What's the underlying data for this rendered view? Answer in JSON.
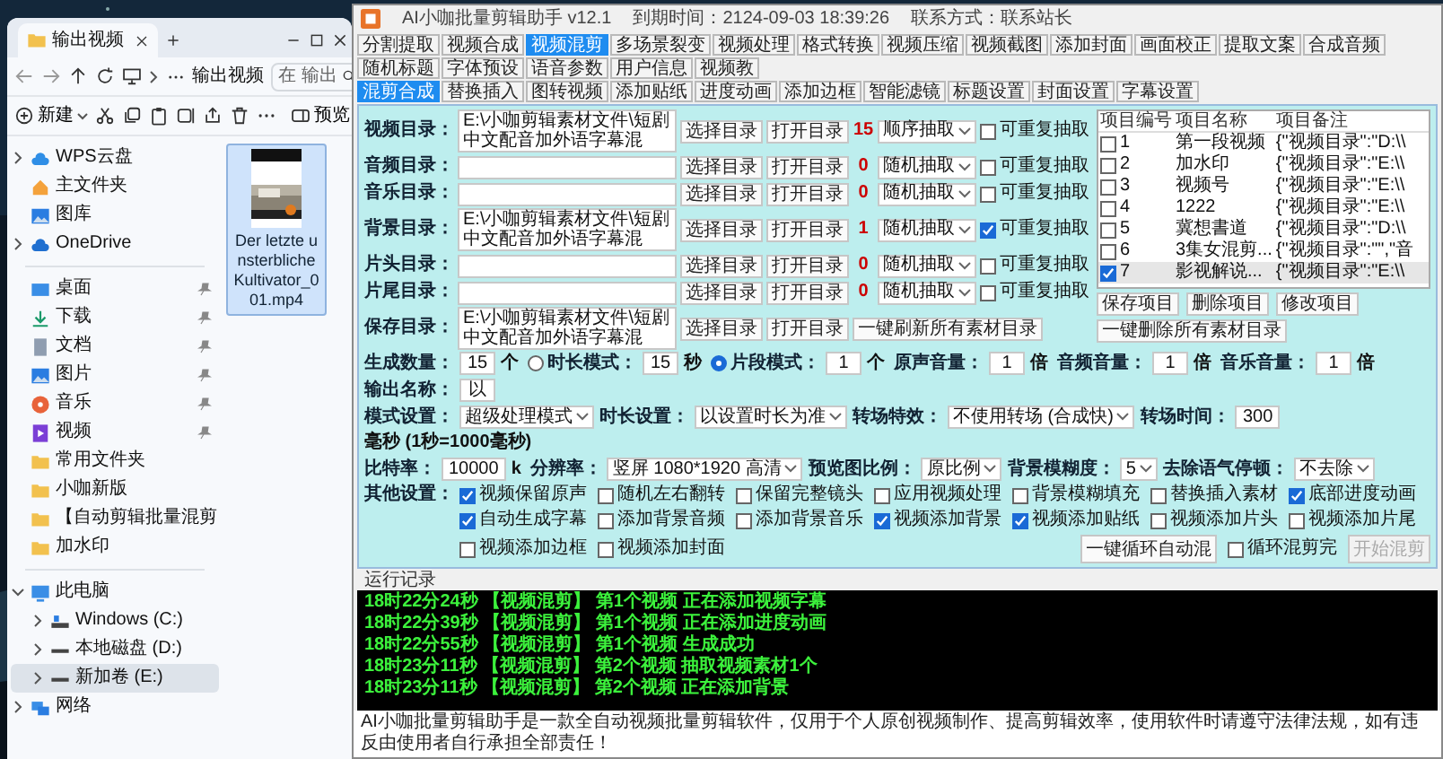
{
  "explorer": {
    "tab_title": "输出视频",
    "breadcrumb": "输出视频",
    "search": {
      "placeholder": "在 输出"
    },
    "new_label": "新建",
    "preview_label": "预览",
    "sidebar": {
      "sections": [
        [
          {
            "label": "WPS云盘",
            "expanded": false,
            "selected": false
          },
          {
            "label": "主文件夹",
            "selected": false
          },
          {
            "label": "图库",
            "selected": false
          },
          {
            "label": "OneDrive",
            "expanded": false,
            "selected": false
          }
        ],
        [
          {
            "label": "桌面",
            "pinned": true,
            "selected": false
          },
          {
            "label": "下载",
            "pinned": true,
            "selected": false
          },
          {
            "label": "文档",
            "pinned": true,
            "selected": false
          },
          {
            "label": "图片",
            "pinned": true,
            "selected": false
          },
          {
            "label": "音乐",
            "pinned": true,
            "selected": false
          },
          {
            "label": "视频",
            "pinned": true,
            "selected": false
          },
          {
            "label": "常用文件夹",
            "pinned": false,
            "selected": false
          },
          {
            "label": "小咖新版",
            "pinned": false,
            "selected": false
          },
          {
            "label": "【自动剪辑批量混剪",
            "pinned": false,
            "selected": false
          },
          {
            "label": "加水印",
            "pinned": false,
            "selected": false
          }
        ],
        [
          {
            "label": "此电脑",
            "expanded": true,
            "selected": false,
            "children": [
              {
                "label": "Windows (C:)",
                "expanded": false,
                "selected": false
              },
              {
                "label": "本地磁盘 (D:)",
                "expanded": false,
                "selected": false
              },
              {
                "label": "新加卷 (E:)",
                "expanded": false,
                "selected": true
              }
            ]
          },
          {
            "label": "网络",
            "expanded": false,
            "selected": false
          }
        ]
      ]
    },
    "files": [
      {
        "name": "Der letzte unsterbliche Kultivator_001.mp4",
        "selected": true
      }
    ]
  },
  "app": {
    "title": "AI小咖批量剪辑助手 v12.1",
    "expiry": "到期时间：2124-09-03 18:39:26",
    "contact": "联系方式：联系站长",
    "tabs": [
      {
        "label": "分割提取",
        "selected": false
      },
      {
        "label": "视频合成",
        "selected": false
      },
      {
        "label": "视频混剪",
        "selected": true
      },
      {
        "label": "多场景裂变",
        "selected": false
      },
      {
        "label": "视频处理",
        "selected": false
      },
      {
        "label": "格式转换",
        "selected": false
      },
      {
        "label": "视频压缩",
        "selected": false
      },
      {
        "label": "视频截图",
        "selected": false
      },
      {
        "label": "添加封面",
        "selected": false
      },
      {
        "label": "画面校正",
        "selected": false
      },
      {
        "label": "提取文案",
        "selected": false
      },
      {
        "label": "合成音频",
        "selected": false
      },
      {
        "label": "随机标题",
        "selected": false
      },
      {
        "label": "字体预设",
        "selected": false
      },
      {
        "label": "语音参数",
        "selected": false
      },
      {
        "label": "用户信息",
        "selected": false
      },
      {
        "label": "视频教",
        "selected": false
      }
    ],
    "subtabs": [
      {
        "label": "混剪合成",
        "selected": true
      },
      {
        "label": "替换插入",
        "selected": false
      },
      {
        "label": "图转视频",
        "selected": false
      },
      {
        "label": "添加贴纸",
        "selected": false
      },
      {
        "label": "进度动画",
        "selected": false
      },
      {
        "label": "添加边框",
        "selected": false
      },
      {
        "label": "智能滤镜",
        "selected": false
      },
      {
        "label": "标题设置",
        "selected": false
      },
      {
        "label": "封面设置",
        "selected": false
      },
      {
        "label": "字幕设置",
        "selected": false
      }
    ],
    "directories": [
      {
        "label": "视频目录：",
        "path": "E:\\小咖剪辑素材文件\\短剧中文配音加外语字幕混",
        "choose_button": "选择目录",
        "open_button": "打开目录",
        "count": "15",
        "order": "顺序抽取",
        "repeat": {
          "label": "可重复抽取",
          "checked": false
        }
      },
      {
        "label": "音频目录：",
        "choose_button": "选择目录",
        "open_button": "打开目录",
        "count": "0",
        "order": "随机抽取",
        "repeat": {
          "label": "可重复抽取",
          "checked": false
        }
      },
      {
        "label": "音乐目录：",
        "choose_button": "选择目录",
        "open_button": "打开目录",
        "count": "0",
        "order": "随机抽取",
        "repeat": {
          "label": "可重复抽取",
          "checked": false
        }
      },
      {
        "label": "背景目录：",
        "path": "E:\\小咖剪辑素材文件\\短剧中文配音加外语字幕混",
        "choose_button": "选择目录",
        "open_button": "打开目录",
        "count": "1",
        "order": "随机抽取",
        "repeat": {
          "label": "可重复抽取",
          "checked": true
        }
      },
      {
        "label": "片头目录：",
        "choose_button": "选择目录",
        "open_button": "打开目录",
        "count": "0",
        "order": "随机抽取",
        "repeat": {
          "label": "可重复抽取",
          "checked": false
        }
      },
      {
        "label": "片尾目录：",
        "choose_button": "选择目录",
        "open_button": "打开目录",
        "count": "0",
        "order": "随机抽取",
        "repeat": {
          "label": "可重复抽取",
          "checked": false
        }
      },
      {
        "label": "保存目录：",
        "path": "E:\\小咖剪辑素材文件\\短剧中文配音加外语字幕混",
        "choose_button": "选择目录",
        "open_button": "打开目录",
        "action_button": "一键刷新所有素材目录"
      }
    ],
    "projects": {
      "columns": [
        "项目编号",
        "项目名称",
        "项目备注"
      ],
      "rows": [
        {
          "number": "1",
          "name": "第一段视频",
          "note": "{\"视频目录\":\"D:\\\\",
          "checked": false
        },
        {
          "number": "2",
          "name": "加水印",
          "note": "{\"视频目录\":\"E:\\\\",
          "checked": false
        },
        {
          "number": "3",
          "name": "视频号",
          "note": "{\"视频目录\":\"E:\\\\",
          "checked": false
        },
        {
          "number": "4",
          "name": "1222",
          "note": "{\"视频目录\":\"E:\\\\",
          "checked": false
        },
        {
          "number": "5",
          "name": "冀想書道",
          "note": "{\"视频目录\":\"D:\\\\",
          "checked": false
        },
        {
          "number": "6",
          "name": "3集女混剪...",
          "note": "{\"视频目录\":\"\",\"音",
          "checked": false
        },
        {
          "number": "7",
          "name": "影视解说...",
          "note": "{\"视频目录\":\"E:\\\\",
          "checked": true
        }
      ],
      "buttons": [
        "保存项目",
        "删除项目",
        "修改项目"
      ],
      "clear_button": "一键删除所有素材目录"
    },
    "settings": [
      [
        {
          "kind": "label",
          "text": "生成数量："
        },
        {
          "kind": "input",
          "value": "15"
        },
        {
          "kind": "unit",
          "text": "个"
        },
        {
          "kind": "radio",
          "text": "时长模式：",
          "selected": false
        },
        {
          "kind": "input",
          "value": "15"
        },
        {
          "kind": "unit",
          "text": "秒"
        },
        {
          "kind": "radio",
          "text": "片段模式：",
          "selected": true
        },
        {
          "kind": "input",
          "value": "1"
        },
        {
          "kind": "unit",
          "text": "个"
        },
        {
          "kind": "label",
          "text": "原声音量："
        },
        {
          "kind": "input",
          "value": "1"
        },
        {
          "kind": "unit",
          "text": "倍"
        },
        {
          "kind": "label",
          "text": "音频音量："
        },
        {
          "kind": "input",
          "value": "1"
        },
        {
          "kind": "unit",
          "text": "倍"
        },
        {
          "kind": "label",
          "text": "音乐音量："
        },
        {
          "kind": "input",
          "value": "1"
        },
        {
          "kind": "unit",
          "text": "倍"
        },
        {
          "kind": "label",
          "text": "输出名称："
        },
        {
          "kind": "input",
          "value": "以"
        }
      ],
      [
        {
          "kind": "label",
          "text": "模式设置："
        },
        {
          "kind": "select",
          "value": "超级处理模式"
        },
        {
          "kind": "label",
          "text": "时长设置："
        },
        {
          "kind": "select",
          "value": "以设置时长为准"
        },
        {
          "kind": "label",
          "text": "转场特效："
        },
        {
          "kind": "select",
          "value": "不使用转场 (合成快)"
        },
        {
          "kind": "label",
          "text": "转场时间："
        },
        {
          "kind": "input",
          "value": "300"
        },
        {
          "kind": "unit",
          "text": "毫秒 (1秒=1000毫秒)"
        }
      ],
      [
        {
          "kind": "label",
          "text": "比特率："
        },
        {
          "kind": "input",
          "value": "10000"
        },
        {
          "kind": "unit",
          "text": "k"
        },
        {
          "kind": "label",
          "text": "分辨率："
        },
        {
          "kind": "select",
          "value": "竖屏 1080*1920 高清"
        },
        {
          "kind": "label",
          "text": "预览图比例："
        },
        {
          "kind": "select",
          "value": "原比例"
        },
        {
          "kind": "label",
          "text": "背景模糊度："
        },
        {
          "kind": "select",
          "value": "5"
        },
        {
          "kind": "label",
          "text": "去除语气停顿："
        },
        {
          "kind": "select",
          "value": "不去除"
        }
      ]
    ],
    "options": {
      "label": "其他设置：",
      "items": [
        {
          "label": "视频保留原声",
          "checked": true
        },
        {
          "label": "随机左右翻转",
          "checked": false
        },
        {
          "label": "保留完整镜头",
          "checked": false
        },
        {
          "label": "应用视频处理",
          "checked": false
        },
        {
          "label": "背景模糊填充",
          "checked": false
        },
        {
          "label": "替换插入素材",
          "checked": false
        },
        {
          "label": "底部进度动画",
          "checked": true
        },
        {
          "label": "自动生成字幕",
          "checked": true
        },
        {
          "label": "添加背景音频",
          "checked": false
        },
        {
          "label": "添加背景音乐",
          "checked": false
        },
        {
          "label": "视频添加背景",
          "checked": true
        },
        {
          "label": "视频添加贴纸",
          "checked": true
        },
        {
          "label": "视频添加片头",
          "checked": false
        },
        {
          "label": "视频添加片尾",
          "checked": false
        },
        {
          "label": "视频添加边框",
          "checked": false
        },
        {
          "label": "视频添加封面",
          "checked": false
        }
      ]
    },
    "loop_button": "一键循环自动混",
    "loop_check": {
      "label": "循环混剪完",
      "checked": false
    },
    "start_button": {
      "label": "开始混剪",
      "disabled": true
    },
    "log": {
      "title": "运行记录",
      "lines": [
        "18时22分24秒 【视频混剪】 第1个视频 正在添加视频字幕",
        "18时22分39秒 【视频混剪】 第1个视频 正在添加进度动画",
        "18时22分55秒 【视频混剪】 第1个视频 生成成功",
        "18时23分11秒 【视频混剪】 第2个视频 抽取视频素材1个",
        "18时23分11秒 【视频混剪】 第2个视频 正在添加背景"
      ]
    },
    "footer": "AI小咖批量剪辑助手是一款全自动视频批量剪辑软件，仅用于个人原创视频制作、提高剪辑效率，使用软件时请遵守法律法规，如有违反由使用者自行承担全部责任！"
  }
}
